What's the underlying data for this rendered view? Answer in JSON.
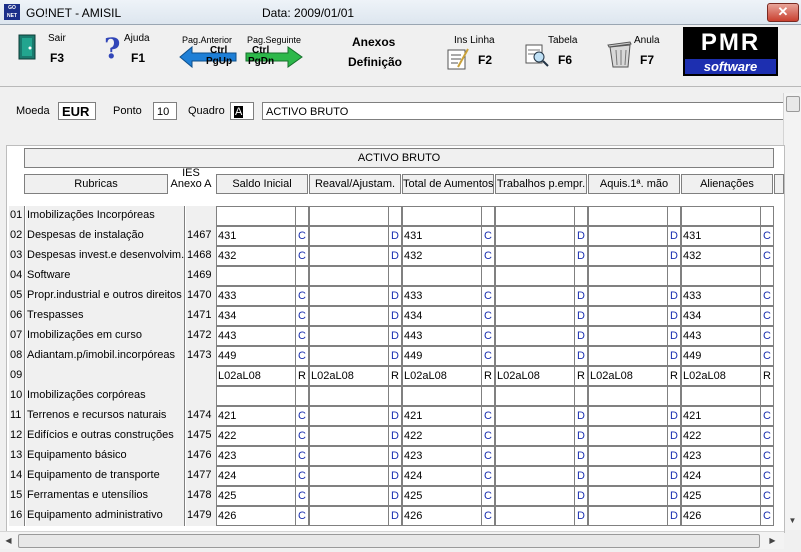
{
  "window": {
    "title": "GO!NET - AMISIL",
    "date": "Data: 2009/01/01"
  },
  "toolbar": {
    "sair": {
      "label": "Sair",
      "key": "F3"
    },
    "ajuda": {
      "label": "Ajuda",
      "key": "F1"
    },
    "pag_anterior": {
      "label": "Pag.Anterior",
      "key1": "Ctrl",
      "key2": "PgUp"
    },
    "pag_seguinte": {
      "label": "Pag.Seguinte",
      "key1": "Ctrl",
      "key2": "PgDn"
    },
    "center": {
      "line1": "Anexos",
      "line2": "Definição"
    },
    "ins_linha": {
      "label": "Ins Linha",
      "key": "F2"
    },
    "tabela": {
      "label": "Tabela",
      "key": "F6"
    },
    "anula": {
      "label": "Anula",
      "key": "F7"
    }
  },
  "logo": {
    "text_top": "PMR",
    "text_bottom": "software"
  },
  "form": {
    "moeda_label": "Moeda",
    "moeda_value": "EUR",
    "ponto_label": "Ponto",
    "ponto_value": "10",
    "quadro_label": "Quadro",
    "quadro_code": "A",
    "quadro_desc": "ACTIVO  BRUTO"
  },
  "grid": {
    "section_title": "ACTIVO  BRUTO",
    "headers": [
      "Rubricas",
      "IES Anexo A",
      "Saldo Inicial",
      "Reaval/Ajustam.",
      "Total de Aumentos",
      "Trabalhos p.empr.",
      "Aquis.1ª. mão",
      "Alienações"
    ],
    "header_ies_line1": "IES",
    "header_ies_line2": "Anexo A",
    "rows": [
      {
        "code": "01",
        "desc": "Imobilizações Incorpóreas",
        "ies": "",
        "v1": "",
        "f1": "",
        "v2": "",
        "f2": "",
        "v3": "",
        "f3": "",
        "v4": "",
        "f4": "",
        "v5": "",
        "f5": "",
        "v6": "",
        "f6": ""
      },
      {
        "code": "02",
        "desc": "Despesas de instalação",
        "ies": "1467",
        "v1": "431",
        "f1": "C",
        "v2": "",
        "f2": "D",
        "v3": "431",
        "f3": "C",
        "v4": "",
        "f4": "D",
        "v5": "",
        "f5": "D",
        "v6": "431",
        "f6": "C"
      },
      {
        "code": "03",
        "desc": "Despesas invest.e desenvolvim.",
        "ies": "1468",
        "v1": "432",
        "f1": "C",
        "v2": "",
        "f2": "D",
        "v3": "432",
        "f3": "C",
        "v4": "",
        "f4": "D",
        "v5": "",
        "f5": "D",
        "v6": "432",
        "f6": "C"
      },
      {
        "code": "04",
        "desc": "    Software",
        "ies": "1469",
        "v1": "",
        "f1": "",
        "v2": "",
        "f2": "",
        "v3": "",
        "f3": "",
        "v4": "",
        "f4": "",
        "v5": "",
        "f5": "",
        "v6": "",
        "f6": ""
      },
      {
        "code": "05",
        "desc": "Propr.industrial e outros direitos",
        "ies": "1470",
        "v1": "433",
        "f1": "C",
        "v2": "",
        "f2": "D",
        "v3": "433",
        "f3": "C",
        "v4": "",
        "f4": "D",
        "v5": "",
        "f5": "D",
        "v6": "433",
        "f6": "C"
      },
      {
        "code": "06",
        "desc": "Trespasses",
        "ies": "1471",
        "v1": "434",
        "f1": "C",
        "v2": "",
        "f2": "D",
        "v3": "434",
        "f3": "C",
        "v4": "",
        "f4": "D",
        "v5": "",
        "f5": "D",
        "v6": "434",
        "f6": "C"
      },
      {
        "code": "07",
        "desc": "Imobilizações em curso",
        "ies": "1472",
        "v1": "443",
        "f1": "C",
        "v2": "",
        "f2": "D",
        "v3": "443",
        "f3": "C",
        "v4": "",
        "f4": "D",
        "v5": "",
        "f5": "D",
        "v6": "443",
        "f6": "C"
      },
      {
        "code": "08",
        "desc": "Adiantam.p/imobil.incorpóreas",
        "ies": "1473",
        "v1": "449",
        "f1": "C",
        "v2": "",
        "f2": "D",
        "v3": "449",
        "f3": "C",
        "v4": "",
        "f4": "D",
        "v5": "",
        "f5": "D",
        "v6": "449",
        "f6": "C"
      },
      {
        "code": "09",
        "desc": "",
        "ies": "",
        "v1": "L02aL08",
        "f1": "R",
        "v2": "L02aL08",
        "f2": "R",
        "v3": "L02aL08",
        "f3": "R",
        "v4": "L02aL08",
        "f4": "R",
        "v5": "L02aL08",
        "f5": "R",
        "v6": "L02aL08",
        "f6": "R"
      },
      {
        "code": "10",
        "desc": "Imobilizações corpóreas",
        "ies": "",
        "v1": "",
        "f1": "",
        "v2": "",
        "f2": "",
        "v3": "",
        "f3": "",
        "v4": "",
        "f4": "",
        "v5": "",
        "f5": "",
        "v6": "",
        "f6": ""
      },
      {
        "code": "11",
        "desc": "Terrenos e recursos naturais",
        "ies": "1474",
        "v1": "421",
        "f1": "C",
        "v2": "",
        "f2": "D",
        "v3": "421",
        "f3": "C",
        "v4": "",
        "f4": "D",
        "v5": "",
        "f5": "D",
        "v6": "421",
        "f6": "C"
      },
      {
        "code": "12",
        "desc": "Edifícios e outras construções",
        "ies": "1475",
        "v1": "422",
        "f1": "C",
        "v2": "",
        "f2": "D",
        "v3": "422",
        "f3": "C",
        "v4": "",
        "f4": "D",
        "v5": "",
        "f5": "D",
        "v6": "422",
        "f6": "C"
      },
      {
        "code": "13",
        "desc": "Equipamento básico",
        "ies": "1476",
        "v1": "423",
        "f1": "C",
        "v2": "",
        "f2": "D",
        "v3": "423",
        "f3": "C",
        "v4": "",
        "f4": "D",
        "v5": "",
        "f5": "D",
        "v6": "423",
        "f6": "C"
      },
      {
        "code": "14",
        "desc": "Equipamento de transporte",
        "ies": "1477",
        "v1": "424",
        "f1": "C",
        "v2": "",
        "f2": "D",
        "v3": "424",
        "f3": "C",
        "v4": "",
        "f4": "D",
        "v5": "",
        "f5": "D",
        "v6": "424",
        "f6": "C"
      },
      {
        "code": "15",
        "desc": "Ferramentas e utensílios",
        "ies": "1478",
        "v1": "425",
        "f1": "C",
        "v2": "",
        "f2": "D",
        "v3": "425",
        "f3": "C",
        "v4": "",
        "f4": "D",
        "v5": "",
        "f5": "D",
        "v6": "425",
        "f6": "C"
      },
      {
        "code": "16",
        "desc": "Equipamento administrativo",
        "ies": "1479",
        "v1": "426",
        "f1": "C",
        "v2": "",
        "f2": "D",
        "v3": "426",
        "f3": "C",
        "v4": "",
        "f4": "D",
        "v5": "",
        "f5": "D",
        "v6": "426",
        "f6": "C"
      }
    ]
  },
  "colors": {
    "flag_blue": "#1a2fb0",
    "logo_blue": "#1d2fb0",
    "close_red": "#c9402f",
    "arrow_green": "#2db84a",
    "arrow_blue": "#1e7fd6"
  }
}
